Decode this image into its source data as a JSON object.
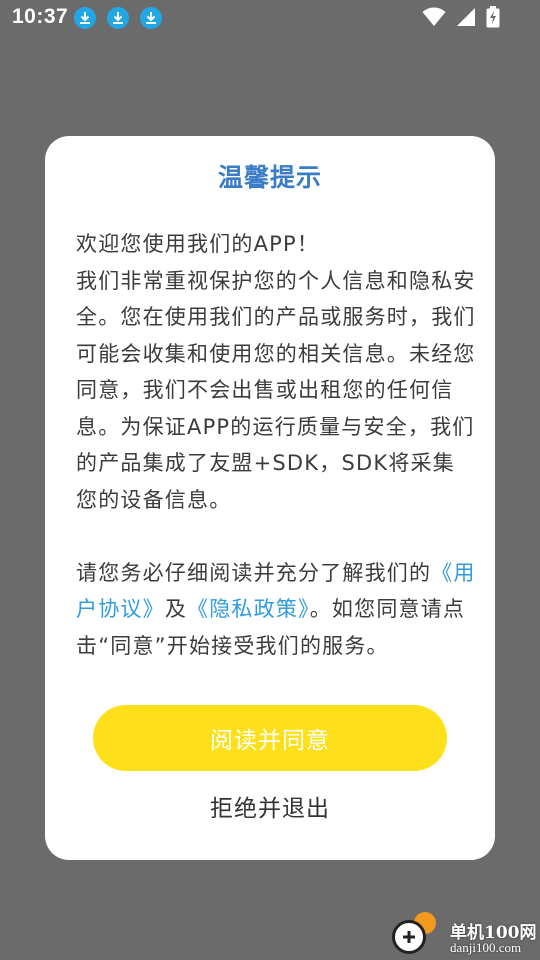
{
  "status_bar": {
    "time": "10:37",
    "notification_icons": [
      "download-icon",
      "download-icon",
      "download-icon"
    ],
    "system_icons": [
      "wifi-icon",
      "signal-icon",
      "battery-charging-icon"
    ]
  },
  "dialog": {
    "title": "温馨提示",
    "body": {
      "paragraph1": "欢迎您使用我们的APP！\n我们非常重视保护您的个人信息和隐私安全。您在使用我们的产品或服务时，我们可能会收集和使用您的相关信息。未经您同意，我们不会出售或出租您的任何信息。为保证APP的运行质量与安全，我们的产品集成了友盟+SDK，SDK将采集您的设备信息。",
      "paragraph2_prefix": "请您务必仔细阅读并充分了解我们的",
      "user_agreement_link": "《用户协议》",
      "and_text": "及",
      "privacy_policy_link": "《隐私政策》",
      "paragraph2_suffix": "。如您同意请点击“同意”开始接受我们的服务。"
    },
    "agree_button": "阅读并同意",
    "reject_button": "拒绝并退出"
  },
  "watermark": {
    "name": "单机100网",
    "url": "danji100.com"
  },
  "colors": {
    "overlay": "#6b6b6b",
    "title": "#3b7cc6",
    "link": "#2f9be0",
    "agree_button": "#fde01a",
    "notification_icon": "#22a7e6"
  }
}
